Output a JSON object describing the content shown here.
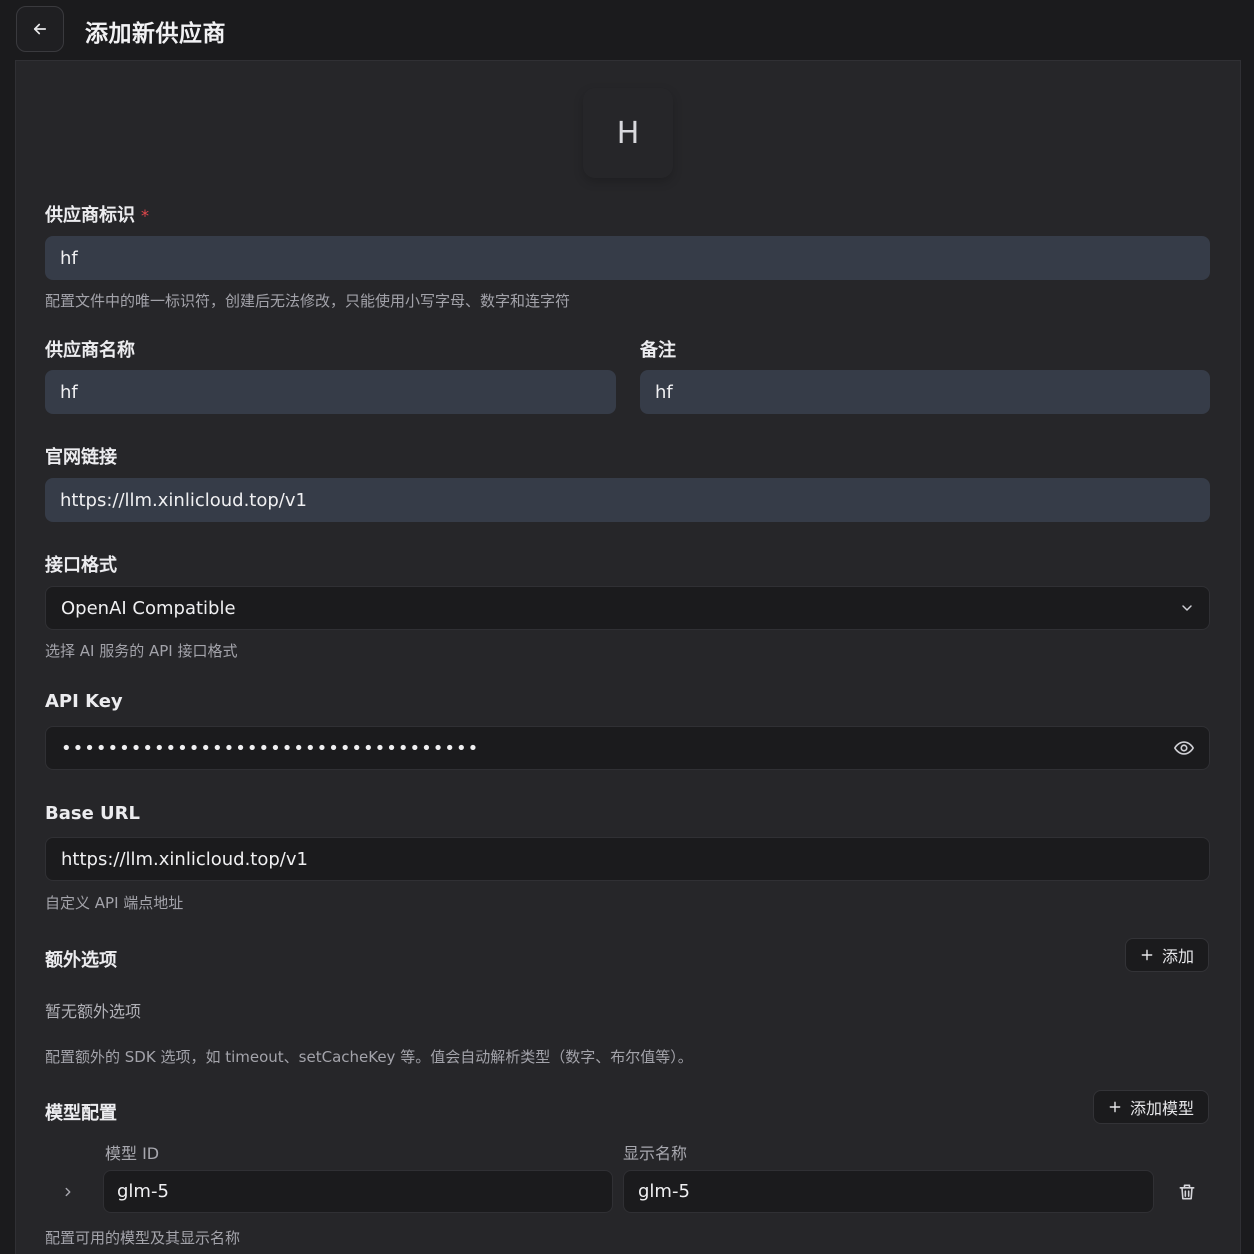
{
  "header": {
    "title": "添加新供应商"
  },
  "avatar": {
    "letter": "H"
  },
  "provider_id": {
    "label": "供应商标识",
    "required_mark": "*",
    "value": "hf",
    "hint": "配置文件中的唯一标识符，创建后无法修改，只能使用小写字母、数字和连字符"
  },
  "provider_name": {
    "label": "供应商名称",
    "value": "hf"
  },
  "notes": {
    "label": "备注",
    "value": "hf"
  },
  "website": {
    "label": "官网链接",
    "value": "https://llm.xinlicloud.top/v1"
  },
  "api_format": {
    "label": "接口格式",
    "selected": "OpenAI Compatible",
    "hint": "选择 AI 服务的 API 接口格式"
  },
  "api_key": {
    "label": "API Key",
    "masked_value": "••••••••••••••••••••••••••••••••••••"
  },
  "base_url": {
    "label": "Base URL",
    "value": "https://llm.xinlicloud.top/v1",
    "hint": "自定义 API 端点地址"
  },
  "extra_options": {
    "label": "额外选项",
    "add_button": "添加",
    "empty_text": "暂无额外选项",
    "hint": "配置额外的 SDK 选项，如 timeout、setCacheKey 等。值会自动解析类型（数字、布尔值等）。"
  },
  "models": {
    "label": "模型配置",
    "add_button": "添加模型",
    "col_id": "模型 ID",
    "col_display": "显示名称",
    "rows": [
      {
        "id": "glm-5",
        "display_name": "glm-5"
      }
    ],
    "hint": "配置可用的模型及其显示名称"
  },
  "icons": {
    "back": "arrow-left-icon",
    "dropdown": "chevron-down-icon",
    "visibility": "eye-icon",
    "add": "plus-icon",
    "expand": "chevron-right-icon",
    "delete": "trash-icon"
  }
}
